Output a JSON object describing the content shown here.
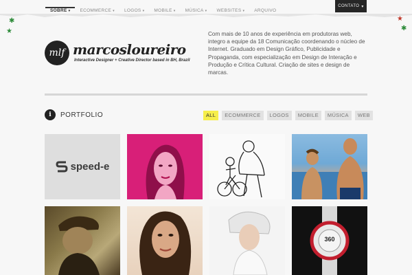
{
  "nav": {
    "items": [
      {
        "label": "SOBRE",
        "caret": true,
        "active": true
      },
      {
        "label": "ECOMMERCE",
        "caret": true,
        "active": false
      },
      {
        "label": "LOGOS",
        "caret": true,
        "active": false
      },
      {
        "label": "MOBILE",
        "caret": true,
        "active": false
      },
      {
        "label": "MÚSICA",
        "caret": true,
        "active": false
      },
      {
        "label": "WEBSITES",
        "caret": true,
        "active": false
      },
      {
        "label": "ARQUIVO",
        "caret": false,
        "active": false
      }
    ],
    "contact_label": "CONTATO"
  },
  "brand": {
    "mark": "mlf",
    "name": "marcosloureiro",
    "tagline": "Interactive Designer + Creative Director based in BH, Brazil"
  },
  "about": {
    "text": "Com mais de 10 anos de experiência em produtoras web, integro a equipe da 18 Comunicação coordenando o núcleo de Internet. Graduado em Design Gráfico, Publicidade e Propaganda, com especialização em Design de Interação e Produção e Crítica Cultural. Criação de sites e design de marcas."
  },
  "portfolio": {
    "icon": "i",
    "title": "PORTFOLIO",
    "filters": [
      "ALL",
      "ECOMMERCE",
      "LOGOS",
      "MOBILE",
      "MÚSICA",
      "WEB"
    ],
    "active_filter": "ALL",
    "tiles": [
      {
        "name": "speed-e-logo-tile",
        "text": "speed-e"
      },
      {
        "name": "woman-magenta-portrait-tile"
      },
      {
        "name": "father-son-bicycle-sketch-tile"
      },
      {
        "name": "father-son-beach-tile"
      },
      {
        "name": "man-cap-sepia-tile"
      },
      {
        "name": "woman-portrait-tile"
      },
      {
        "name": "bride-portrait-tile"
      },
      {
        "name": "sport-watch-tile",
        "text": "360"
      }
    ]
  },
  "colors": {
    "filter_active": "#f6ee4b",
    "contact_bg": "#262626",
    "magenta": "#d81f78"
  }
}
